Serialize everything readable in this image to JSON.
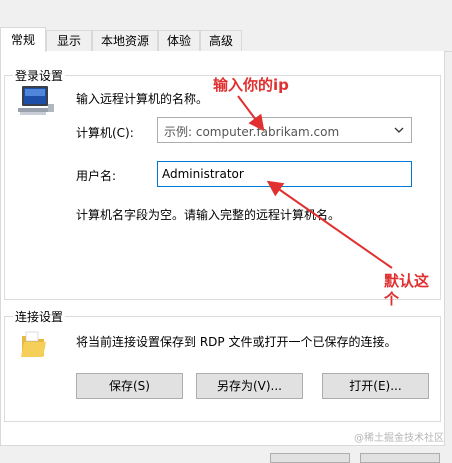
{
  "tabs": [
    {
      "label": "常规"
    },
    {
      "label": "显示"
    },
    {
      "label": "本地资源"
    },
    {
      "label": "体验"
    },
    {
      "label": "高级"
    }
  ],
  "login": {
    "legend": "登录设置",
    "instruction": "输入远程计算机的名称。",
    "computer_label": "计算机(C):",
    "computer_placeholder": "示例: computer.fabrikam.com",
    "username_label": "用户名:",
    "username_value": "Administrator",
    "note": "计算机名字段为空。请输入完整的远程计算机名。"
  },
  "connection": {
    "legend": "连接设置",
    "description": "将当前连接设置保存到 RDP 文件或打开一个已保存的连接。",
    "save_label": "保存(S)",
    "save_as_label": "另存为(V)...",
    "open_label": "打开(E)..."
  },
  "annotations": {
    "enter_ip": "输入你的ip",
    "default_this": "默认这个"
  },
  "watermark": "@稀土掘金技术社区",
  "colors": {
    "accent": "#0078d7",
    "annotation": "#e03030"
  }
}
